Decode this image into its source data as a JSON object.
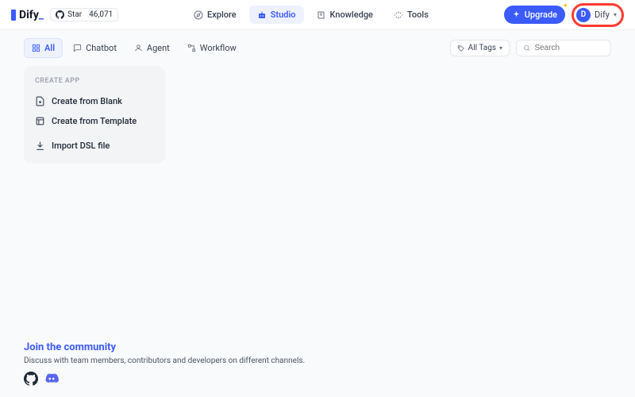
{
  "brand": {
    "name": "Dify"
  },
  "github": {
    "star_label": "Star",
    "count": "46,071"
  },
  "nav": {
    "explore": "Explore",
    "studio": "Studio",
    "knowledge": "Knowledge",
    "tools": "Tools"
  },
  "upgrade": {
    "label": "Upgrade"
  },
  "user": {
    "initial": "D",
    "name": "Dify"
  },
  "filters": {
    "all": "All",
    "chatbot": "Chatbot",
    "agent": "Agent",
    "workflow": "Workflow"
  },
  "tags": {
    "label": "All Tags"
  },
  "search": {
    "placeholder": "Search"
  },
  "create_card": {
    "title": "CREATE APP",
    "blank": "Create from Blank",
    "template": "Create from Template",
    "import": "Import DSL file"
  },
  "community": {
    "title": "Join the community",
    "subtitle": "Discuss with team members, contributors and developers on different channels."
  }
}
